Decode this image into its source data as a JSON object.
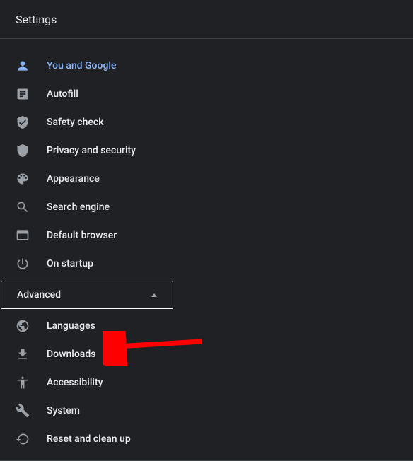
{
  "header": {
    "title": "Settings"
  },
  "nav": {
    "items": [
      {
        "label": "You and Google",
        "icon": "person-icon",
        "active": true
      },
      {
        "label": "Autofill",
        "icon": "autofill-icon",
        "active": false
      },
      {
        "label": "Safety check",
        "icon": "safety-check-icon",
        "active": false
      },
      {
        "label": "Privacy and security",
        "icon": "privacy-icon",
        "active": false
      },
      {
        "label": "Appearance",
        "icon": "appearance-icon",
        "active": false
      },
      {
        "label": "Search engine",
        "icon": "search-icon",
        "active": false
      },
      {
        "label": "Default browser",
        "icon": "browser-icon",
        "active": false
      },
      {
        "label": "On startup",
        "icon": "power-icon",
        "active": false
      }
    ]
  },
  "advanced": {
    "label": "Advanced",
    "expanded": true,
    "items": [
      {
        "label": "Languages",
        "icon": "globe-icon"
      },
      {
        "label": "Downloads",
        "icon": "download-icon"
      },
      {
        "label": "Accessibility",
        "icon": "accessibility-icon"
      },
      {
        "label": "System",
        "icon": "system-icon"
      },
      {
        "label": "Reset and clean up",
        "icon": "reset-icon"
      }
    ]
  },
  "annotation": {
    "arrow_target": "Downloads",
    "arrow_color": "#ff0000"
  }
}
